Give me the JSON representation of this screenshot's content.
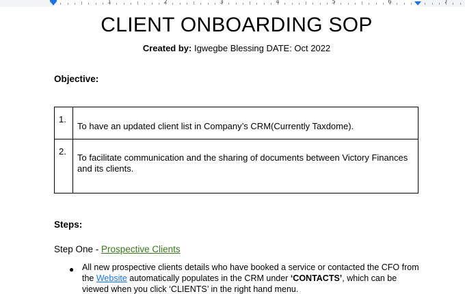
{
  "ruler": {
    "numbers": [
      "1",
      "2",
      "3",
      "4",
      "5",
      "6",
      "7"
    ]
  },
  "document": {
    "title": "CLIENT ONBOARDING SOP",
    "created_by_label": "Created by:",
    "created_by_value": " Igwegbe Blessing  DATE: Oct 2022",
    "objective_heading": "Objective:",
    "objectives": [
      {
        "num": "1.",
        "text": "To have an updated client list in Company’s CRM(Currently Taxdome)."
      },
      {
        "num": "2.",
        "text": "To facilitate communication and the sharing of documents between Victory Finances and its clients."
      }
    ],
    "steps_heading": "Steps:",
    "step_one_prefix": "Step One - ",
    "step_one_link": "Prospective Clients",
    "bullet": {
      "symbol": "●",
      "text_1": "All new prospective clients details who have booked a service or contacted the CFO from the ",
      "link": "Website",
      "text_2": " automatically populates in the CRM under ",
      "bold": "‘CONTACTS’",
      "text_3": ", which can be viewed when you click ‘CLIENTS’ in the right hand menu."
    }
  },
  "colors": {
    "link_blue": "#1a73e8",
    "link_green": "#38761d",
    "ruler_marker": "#1a73e8"
  }
}
